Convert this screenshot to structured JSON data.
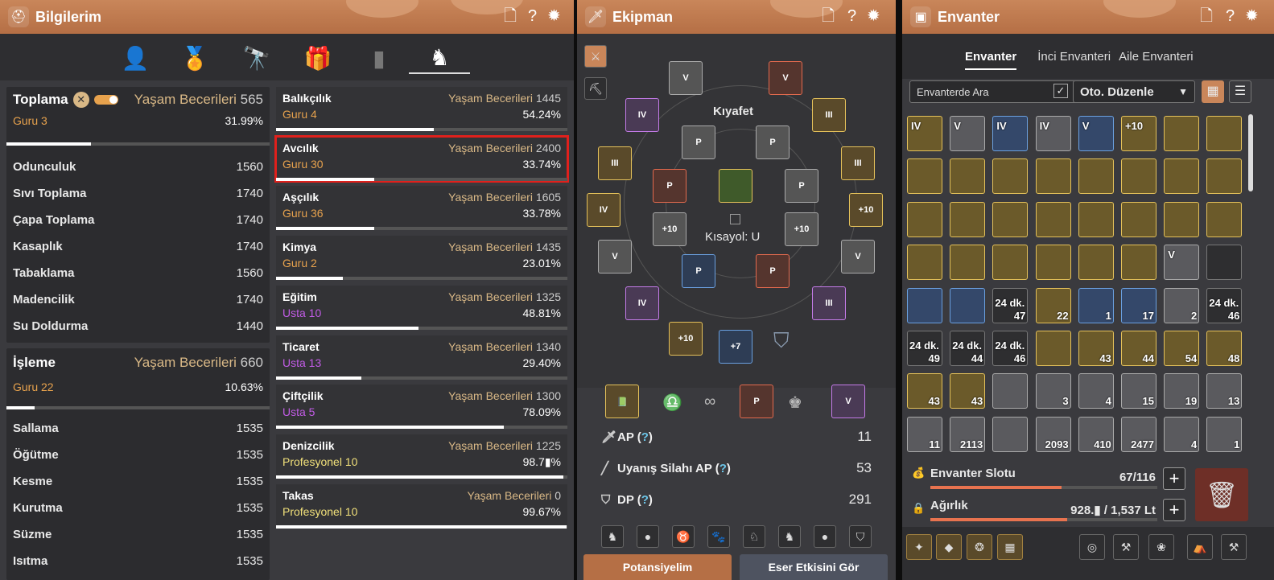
{
  "window1": {
    "title": "Bilgilerim",
    "header_icons": [
      "doc-icon",
      "help-icon",
      "settings-icon"
    ],
    "tabs": [
      "person-icon",
      "medal-icon",
      "telescope-icon",
      "gift-icon",
      "chart-icon",
      "horse-icon"
    ],
    "toplama": {
      "name": "Toplama",
      "life_label": "Yaşam Becerileri",
      "life_value": "565",
      "rank": "Guru 3",
      "percent": "31.99%",
      "progress": 0.3199,
      "items": [
        {
          "name": "Odunculuk",
          "value": "1560"
        },
        {
          "name": "Sıvı Toplama",
          "value": "1740"
        },
        {
          "name": "Çapa Toplama",
          "value": "1740"
        },
        {
          "name": "Kasaplık",
          "value": "1740"
        },
        {
          "name": "Tabaklama",
          "value": "1560"
        },
        {
          "name": "Madencilik",
          "value": "1740"
        },
        {
          "name": "Su Doldurma",
          "value": "1440"
        }
      ]
    },
    "isleme": {
      "name": "İşleme",
      "life_label": "Yaşam Becerileri",
      "life_value": "660",
      "rank": "Guru 22",
      "percent": "10.63%",
      "progress": 0.1063,
      "items": [
        {
          "name": "Sallama",
          "value": "1535"
        },
        {
          "name": "Öğütme",
          "value": "1535"
        },
        {
          "name": "Kesme",
          "value": "1535"
        },
        {
          "name": "Kurutma",
          "value": "1535"
        },
        {
          "name": "Süzme",
          "value": "1535"
        },
        {
          "name": "Isıtma",
          "value": "1535"
        }
      ]
    },
    "skills": [
      {
        "name": "Balıkçılık",
        "life_label": "Yaşam Becerileri",
        "life_value": "1445",
        "rank": "Guru 4",
        "rank_type": "guru",
        "percent": "54.24%",
        "progress": 0.5424
      },
      {
        "name": "Avcılık",
        "life_label": "Yaşam Becerileri",
        "life_value": "2400",
        "rank": "Guru 30",
        "rank_type": "guru",
        "percent": "33.74%",
        "progress": 0.3374,
        "selected": true
      },
      {
        "name": "Aşçılık",
        "life_label": "Yaşam Becerileri",
        "life_value": "1605",
        "rank": "Guru 36",
        "rank_type": "guru",
        "percent": "33.78%",
        "progress": 0.3378
      },
      {
        "name": "Kimya",
        "life_label": "Yaşam Becerileri",
        "life_value": "1435",
        "rank": "Guru 2",
        "rank_type": "guru",
        "percent": "23.01%",
        "progress": 0.2301
      },
      {
        "name": "Eğitim",
        "life_label": "Yaşam Becerileri",
        "life_value": "1325",
        "rank": "Usta 10",
        "rank_type": "usta",
        "percent": "48.81%",
        "progress": 0.4881
      },
      {
        "name": "Ticaret",
        "life_label": "Yaşam Becerileri",
        "life_value": "1340",
        "rank": "Usta 13",
        "rank_type": "usta",
        "percent": "29.40%",
        "progress": 0.294
      },
      {
        "name": "Çiftçilik",
        "life_label": "Yaşam Becerileri",
        "life_value": "1300",
        "rank": "Usta 5",
        "rank_type": "usta",
        "percent": "78.09%",
        "progress": 0.7809
      },
      {
        "name": "Denizcilik",
        "life_label": "Yaşam Becerileri",
        "life_value": "1225",
        "rank": "Profesyonel 10",
        "rank_type": "prof",
        "percent": "98.7▮%",
        "progress": 0.987
      },
      {
        "name": "Takas",
        "life_label": "Yaşam Becerileri",
        "life_value": "0",
        "rank": "Profesyonel 10",
        "rank_type": "prof",
        "percent": "99.67%",
        "progress": 0.9967
      }
    ]
  },
  "window2": {
    "title": "Ekipman",
    "costume_label": "Kıyafet",
    "shortcut_label": "Kısayol: U",
    "slots": [
      "V",
      "V",
      "IV",
      "III",
      "P",
      "P",
      "III",
      "III",
      "P",
      "P",
      "+10",
      "+10",
      "V",
      "V",
      "P",
      "P",
      "IV",
      "III",
      "+10",
      "+7",
      "IV",
      "+10"
    ],
    "stats": [
      {
        "icon": "sword-icon",
        "label": "AP",
        "q": "?",
        "value": "11"
      },
      {
        "icon": "awaken-icon",
        "label": "Uyanış Silahı AP",
        "q": "?",
        "value": "53"
      },
      {
        "icon": "shield-icon",
        "label": "DP",
        "q": "?",
        "value": "291"
      }
    ],
    "buttons": {
      "potential": "Potansiyelim",
      "artifact": "Eser Etkisini Gör"
    }
  },
  "window3": {
    "title": "Envanter",
    "tabs": [
      "Envanter",
      "İnci Envanteri",
      "Aile Envanteri"
    ],
    "search_placeholder": "Envanterde Ara",
    "auto_sort": "Oto. Düzenle",
    "items": [
      [
        "IV",
        "V",
        "IV",
        "IV",
        "V",
        "+10",
        "",
        ""
      ],
      [
        "",
        "",
        "",
        "",
        "",
        "",
        "",
        ""
      ],
      [
        "",
        "",
        "",
        "",
        "",
        "",
        "",
        ""
      ],
      [
        "",
        "",
        "",
        "",
        "",
        "",
        "V",
        ""
      ],
      [
        "",
        "",
        "24 dk.|47",
        "22",
        "1",
        "17",
        "2",
        "24 dk.|46"
      ],
      [
        "24 dk.|49",
        "24 dk.|44",
        "24 dk.|46",
        "",
        "43",
        "44",
        "54",
        "48"
      ],
      [
        "43",
        "43",
        "",
        "3",
        "4",
        "15",
        "19",
        "13"
      ],
      [
        "11",
        "2113",
        "",
        "2093",
        "410",
        "2477",
        "4",
        "1"
      ]
    ],
    "slot_label": "Envanter Slotu",
    "slot_value": "67/116",
    "slot_progress": 0.578,
    "weight_label": "Ağırlık",
    "weight_value": "928.▮ / 1,537 Lt",
    "weight_progress": 0.604
  }
}
